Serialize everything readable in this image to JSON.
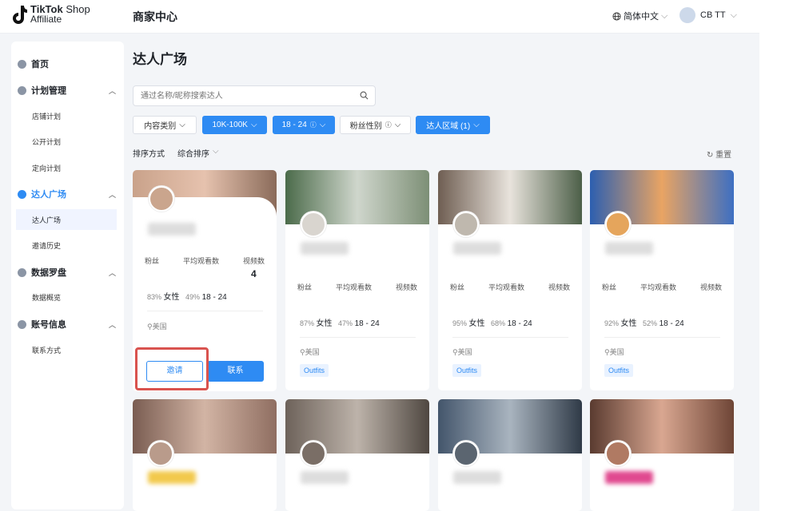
{
  "brand": {
    "name_bold": "TikTok",
    "name_light": " Shop",
    "sub": "Affiliate"
  },
  "header": {
    "page_name": "商家中心",
    "language": "简体中文",
    "user": "CB TT"
  },
  "sidebar": {
    "items": [
      {
        "label": "首页",
        "kind": "group"
      },
      {
        "label": "计划管理",
        "kind": "group",
        "expanded": true
      },
      {
        "label": "店铺计划",
        "kind": "sub"
      },
      {
        "label": "公开计划",
        "kind": "sub"
      },
      {
        "label": "定向计划",
        "kind": "sub"
      },
      {
        "label": "达人广场",
        "kind": "group",
        "expanded": true
      },
      {
        "label": "达人广场",
        "kind": "sub",
        "active": true
      },
      {
        "label": "邀请历史",
        "kind": "sub"
      },
      {
        "label": "数据罗盘",
        "kind": "group",
        "expanded": true
      },
      {
        "label": "数据概览",
        "kind": "sub"
      },
      {
        "label": "账号信息",
        "kind": "group",
        "expanded": true
      },
      {
        "label": "联系方式",
        "kind": "sub"
      }
    ]
  },
  "main": {
    "title": "达人广场",
    "search": {
      "placeholder": "通过名称/昵称搜索达人",
      "value": ""
    },
    "filters": [
      {
        "label": "内容类别",
        "active": false
      },
      {
        "label": "10K-100K",
        "active": true
      },
      {
        "label": "18 - 24",
        "active": true
      },
      {
        "label": "粉丝性别",
        "active": false
      },
      {
        "label": "达人区域 (1)",
        "active": true
      }
    ],
    "sort": {
      "label": "排序方式",
      "value": "综合排序"
    },
    "reset": "重置",
    "stat_headers": {
      "followers": "粉丝",
      "avg_views": "平均观看数",
      "videos": "视频数"
    },
    "cards": [
      {
        "female_pct": "83%",
        "female_label": "女性",
        "age_pct": "49%",
        "age_range": "18 - 24",
        "region": "美国",
        "tag": "",
        "videos_partial": "4",
        "invite": "邀请",
        "contact": "联系"
      },
      {
        "female_pct": "87%",
        "female_label": "女性",
        "age_pct": "47%",
        "age_range": "18 - 24",
        "region": "美国",
        "tag": "Outfits"
      },
      {
        "female_pct": "95%",
        "female_label": "女性",
        "age_pct": "68%",
        "age_range": "18 - 24",
        "region": "美国",
        "tag": "Outfits"
      },
      {
        "female_pct": "92%",
        "female_label": "女性",
        "age_pct": "52%",
        "age_range": "18 - 24",
        "region": "美国",
        "tag": "Outfits"
      }
    ]
  },
  "colors": {
    "primary": "#2e8bf3",
    "highlight": "#d9534f"
  }
}
